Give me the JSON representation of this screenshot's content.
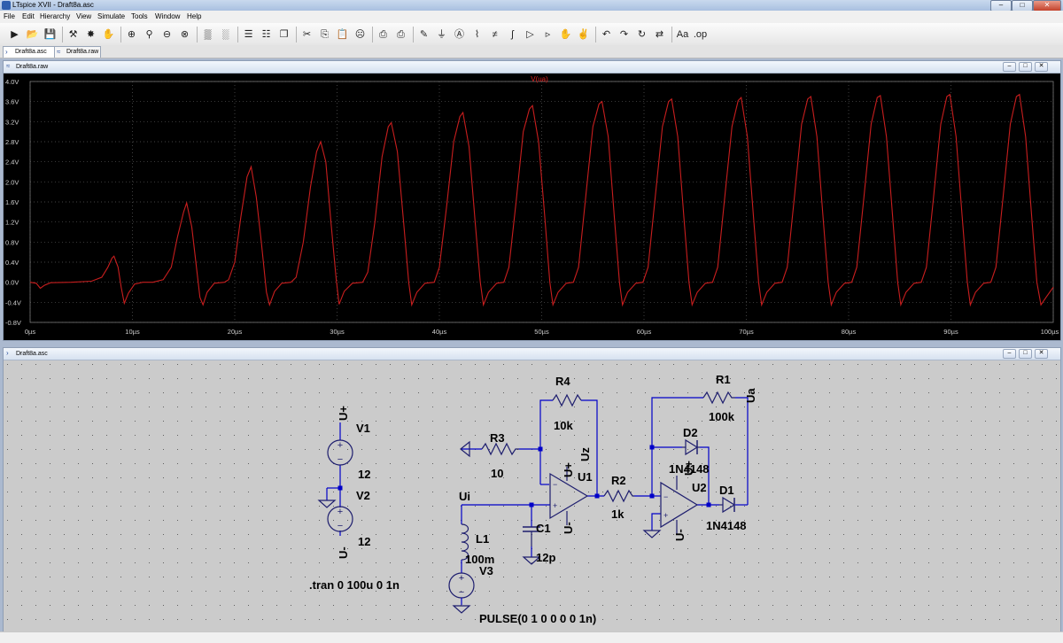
{
  "window": {
    "title": "LTspice XVII - Draft8a.asc",
    "minimize": "–",
    "maximize": "□",
    "close": "✕"
  },
  "menu": [
    "File",
    "Edit",
    "Hierarchy",
    "View",
    "Simulate",
    "Tools",
    "Window",
    "Help"
  ],
  "toolbar": [
    {
      "icon": "new-schematic-icon",
      "glyph": "▶"
    },
    {
      "icon": "open-folder-icon",
      "glyph": "📂"
    },
    {
      "icon": "save-icon",
      "glyph": "💾"
    },
    {
      "icon": "control-panel-icon",
      "glyph": "⚒"
    },
    {
      "icon": "run-icon",
      "glyph": "✸"
    },
    {
      "icon": "pan-icon",
      "glyph": "✋"
    },
    {
      "icon": "zoom-in-icon",
      "glyph": "⊕"
    },
    {
      "icon": "zoom-icon",
      "glyph": "⚲"
    },
    {
      "icon": "zoom-out-icon",
      "glyph": "⊖"
    },
    {
      "icon": "zoom-cancel-icon",
      "glyph": "⊗"
    },
    {
      "icon": "autorange-icon",
      "glyph": "▒"
    },
    {
      "icon": "fit-icon",
      "glyph": "░"
    },
    {
      "icon": "tile-horizontal-icon",
      "glyph": "☰"
    },
    {
      "icon": "tile-vertical-icon",
      "glyph": "☷"
    },
    {
      "icon": "cascade-icon",
      "glyph": "❐"
    },
    {
      "icon": "cut-icon",
      "glyph": "✂"
    },
    {
      "icon": "copy-icon",
      "glyph": "⎘"
    },
    {
      "icon": "paste-icon",
      "glyph": "📋"
    },
    {
      "icon": "find-icon",
      "glyph": "☹"
    },
    {
      "icon": "print-icon",
      "glyph": "⎙"
    },
    {
      "icon": "print-setup-icon",
      "glyph": "⎙"
    },
    {
      "icon": "draw-wire-icon",
      "glyph": "✎"
    },
    {
      "icon": "ground-icon",
      "glyph": "⏚"
    },
    {
      "icon": "label-net-icon",
      "glyph": "Ⓐ"
    },
    {
      "icon": "resistor-icon",
      "glyph": "⌇"
    },
    {
      "icon": "capacitor-icon",
      "glyph": "≠"
    },
    {
      "icon": "inductor-icon",
      "glyph": "ʃ"
    },
    {
      "icon": "diode-icon",
      "glyph": "▷"
    },
    {
      "icon": "component-icon",
      "glyph": "▹"
    },
    {
      "icon": "move-icon",
      "glyph": "✋"
    },
    {
      "icon": "drag-icon",
      "glyph": "✌"
    },
    {
      "icon": "undo-icon",
      "glyph": "↶"
    },
    {
      "icon": "redo-icon",
      "glyph": "↷"
    },
    {
      "icon": "rotate-icon",
      "glyph": "↻"
    },
    {
      "icon": "mirror-icon",
      "glyph": "⇄"
    },
    {
      "icon": "text-icon",
      "glyph": "Aa"
    },
    {
      "icon": "spice-directive-icon",
      "glyph": ".op"
    }
  ],
  "tabs": [
    {
      "label": "Draft8a.asc",
      "icon": "schematic-tab-icon"
    },
    {
      "label": "Draft8a.raw",
      "icon": "waveform-tab-icon"
    }
  ],
  "plot_window": {
    "title": "Draft8a.raw"
  },
  "schematic_window": {
    "title": "Draft8a.asc"
  },
  "colors": {
    "trace": "#c81e1e",
    "plot_bg": "#000000",
    "grid": "#5a5a5a",
    "wire": "#0000c8",
    "component": "#1e1e6e",
    "schematic_bg": "#cbcbcb"
  },
  "chart_data": {
    "type": "line",
    "series": [
      {
        "name": "V(ua)",
        "x_unit": "µs",
        "points": [
          [
            0,
            0.0
          ],
          [
            0.6,
            -0.02
          ],
          [
            1.0,
            -0.12
          ],
          [
            1.4,
            -0.06
          ],
          [
            2,
            -0.01
          ],
          [
            4,
            0.0
          ],
          [
            6,
            0.02
          ],
          [
            7,
            0.1
          ],
          [
            7.6,
            0.3
          ],
          [
            8,
            0.48
          ],
          [
            8.2,
            0.52
          ],
          [
            8.6,
            0.3
          ],
          [
            8.9,
            -0.1
          ],
          [
            9.2,
            -0.42
          ],
          [
            9.6,
            -0.22
          ],
          [
            10.2,
            -0.04
          ],
          [
            11,
            0.0
          ],
          [
            12,
            0.0
          ],
          [
            13,
            0.05
          ],
          [
            13.8,
            0.3
          ],
          [
            14.4,
            0.9
          ],
          [
            15,
            1.4
          ],
          [
            15.3,
            1.58
          ],
          [
            15.8,
            1.1
          ],
          [
            16.2,
            0.4
          ],
          [
            16.6,
            -0.3
          ],
          [
            16.9,
            -0.45
          ],
          [
            17.3,
            -0.2
          ],
          [
            18,
            -0.02
          ],
          [
            19,
            0.0
          ],
          [
            19.4,
            0.05
          ],
          [
            20,
            0.4
          ],
          [
            20.6,
            1.3
          ],
          [
            21.2,
            2.1
          ],
          [
            21.6,
            2.3
          ],
          [
            22.1,
            1.7
          ],
          [
            22.6,
            0.8
          ],
          [
            23.1,
            -0.2
          ],
          [
            23.4,
            -0.45
          ],
          [
            23.9,
            -0.18
          ],
          [
            24.6,
            -0.02
          ],
          [
            25.5,
            0.0
          ],
          [
            26,
            0.1
          ],
          [
            26.7,
            0.8
          ],
          [
            27.4,
            1.9
          ],
          [
            28,
            2.6
          ],
          [
            28.4,
            2.8
          ],
          [
            28.9,
            2.4
          ],
          [
            29.4,
            1.2
          ],
          [
            29.9,
            0.1
          ],
          [
            30.2,
            -0.44
          ],
          [
            30.7,
            -0.18
          ],
          [
            31.5,
            -0.02
          ],
          [
            32.5,
            0.0
          ],
          [
            33,
            0.2
          ],
          [
            33.7,
            1.2
          ],
          [
            34.4,
            2.5
          ],
          [
            35,
            3.1
          ],
          [
            35.3,
            3.18
          ],
          [
            35.9,
            2.6
          ],
          [
            36.5,
            1.2
          ],
          [
            37,
            0.0
          ],
          [
            37.3,
            -0.45
          ],
          [
            37.8,
            -0.2
          ],
          [
            38.6,
            -0.02
          ],
          [
            39.5,
            0.0
          ],
          [
            40,
            0.3
          ],
          [
            40.7,
            1.5
          ],
          [
            41.4,
            2.8
          ],
          [
            42,
            3.3
          ],
          [
            42.3,
            3.38
          ],
          [
            42.9,
            2.7
          ],
          [
            43.5,
            1.2
          ],
          [
            44,
            0.0
          ],
          [
            44.3,
            -0.45
          ],
          [
            44.8,
            -0.2
          ],
          [
            45.6,
            -0.02
          ],
          [
            46.3,
            0.0
          ],
          [
            46.8,
            0.3
          ],
          [
            47.5,
            1.6
          ],
          [
            48.2,
            3.0
          ],
          [
            48.8,
            3.45
          ],
          [
            49.1,
            3.52
          ],
          [
            49.7,
            2.8
          ],
          [
            50.3,
            1.3
          ],
          [
            50.8,
            0.0
          ],
          [
            51.1,
            -0.45
          ],
          [
            51.6,
            -0.2
          ],
          [
            52.4,
            -0.02
          ],
          [
            53.1,
            0.0
          ],
          [
            53.6,
            0.3
          ],
          [
            54.3,
            1.7
          ],
          [
            55,
            3.1
          ],
          [
            55.6,
            3.55
          ],
          [
            55.9,
            3.6
          ],
          [
            56.5,
            2.9
          ],
          [
            57.1,
            1.3
          ],
          [
            57.6,
            0.0
          ],
          [
            57.9,
            -0.45
          ],
          [
            58.4,
            -0.2
          ],
          [
            59.2,
            -0.02
          ],
          [
            59.9,
            0.0
          ],
          [
            60.4,
            0.3
          ],
          [
            61.1,
            1.7
          ],
          [
            61.8,
            3.1
          ],
          [
            62.4,
            3.6
          ],
          [
            62.7,
            3.65
          ],
          [
            63.3,
            2.9
          ],
          [
            63.9,
            1.3
          ],
          [
            64.4,
            0.0
          ],
          [
            64.7,
            -0.45
          ],
          [
            65.2,
            -0.2
          ],
          [
            66,
            -0.02
          ],
          [
            66.7,
            0.0
          ],
          [
            67.2,
            0.3
          ],
          [
            67.9,
            1.7
          ],
          [
            68.6,
            3.1
          ],
          [
            69.2,
            3.62
          ],
          [
            69.5,
            3.68
          ],
          [
            70.1,
            2.9
          ],
          [
            70.7,
            1.3
          ],
          [
            71.2,
            0.0
          ],
          [
            71.5,
            -0.45
          ],
          [
            72,
            -0.2
          ],
          [
            72.8,
            -0.02
          ],
          [
            73.5,
            0.0
          ],
          [
            74,
            0.3
          ],
          [
            74.7,
            1.7
          ],
          [
            75.4,
            3.15
          ],
          [
            76,
            3.65
          ],
          [
            76.3,
            3.7
          ],
          [
            76.9,
            2.9
          ],
          [
            77.5,
            1.3
          ],
          [
            78,
            0.0
          ],
          [
            78.3,
            -0.45
          ],
          [
            78.8,
            -0.2
          ],
          [
            79.6,
            -0.02
          ],
          [
            80.3,
            0.0
          ],
          [
            80.8,
            0.3
          ],
          [
            81.5,
            1.7
          ],
          [
            82.2,
            3.15
          ],
          [
            82.8,
            3.68
          ],
          [
            83.1,
            3.72
          ],
          [
            83.7,
            2.9
          ],
          [
            84.3,
            1.3
          ],
          [
            84.8,
            0.0
          ],
          [
            85.1,
            -0.45
          ],
          [
            85.6,
            -0.2
          ],
          [
            86.4,
            -0.02
          ],
          [
            87.1,
            0.0
          ],
          [
            87.6,
            0.3
          ],
          [
            88.3,
            1.7
          ],
          [
            89,
            3.15
          ],
          [
            89.6,
            3.7
          ],
          [
            89.9,
            3.74
          ],
          [
            90.5,
            2.9
          ],
          [
            91.1,
            1.3
          ],
          [
            91.6,
            0.0
          ],
          [
            91.9,
            -0.45
          ],
          [
            92.4,
            -0.2
          ],
          [
            93.2,
            -0.02
          ],
          [
            93.9,
            0.0
          ],
          [
            94.4,
            0.3
          ],
          [
            95.1,
            1.7
          ],
          [
            95.8,
            3.15
          ],
          [
            96.4,
            3.7
          ],
          [
            96.7,
            3.74
          ],
          [
            97.3,
            2.9
          ],
          [
            97.9,
            1.3
          ],
          [
            98.4,
            0.0
          ],
          [
            98.8,
            -0.45
          ],
          [
            99.3,
            -0.3
          ],
          [
            100,
            -0.1
          ]
        ]
      }
    ],
    "xlim": [
      0,
      100
    ],
    "ylim": [
      -0.8,
      4.0
    ],
    "x_ticks": [
      {
        "v": 0,
        "label": "0µs"
      },
      {
        "v": 10,
        "label": "10µs"
      },
      {
        "v": 20,
        "label": "20µs"
      },
      {
        "v": 30,
        "label": "30µs"
      },
      {
        "v": 40,
        "label": "40µs"
      },
      {
        "v": 50,
        "label": "50µs"
      },
      {
        "v": 60,
        "label": "60µs"
      },
      {
        "v": 70,
        "label": "70µs"
      },
      {
        "v": 80,
        "label": "80µs"
      },
      {
        "v": 90,
        "label": "90µs"
      },
      {
        "v": 100,
        "label": "100µs"
      }
    ],
    "y_ticks": [
      {
        "v": 4.0,
        "label": "4.0V"
      },
      {
        "v": 3.6,
        "label": "3.6V"
      },
      {
        "v": 3.2,
        "label": "3.2V"
      },
      {
        "v": 2.8,
        "label": "2.8V"
      },
      {
        "v": 2.4,
        "label": "2.4V"
      },
      {
        "v": 2.0,
        "label": "2.0V"
      },
      {
        "v": 1.6,
        "label": "1.6V"
      },
      {
        "v": 1.2,
        "label": "1.2V"
      },
      {
        "v": 0.8,
        "label": "0.8V"
      },
      {
        "v": 0.4,
        "label": "0.4V"
      },
      {
        "v": 0.0,
        "label": "0.0V"
      },
      {
        "v": -0.4,
        "label": "-0.4V"
      },
      {
        "v": -0.8,
        "label": "-0.8V"
      }
    ],
    "grid": true
  },
  "schematic": {
    "labels": {
      "v1_name": "V1",
      "v1_value": "12",
      "v2_name": "V2",
      "v2_value": "12",
      "uplus_top": "U+",
      "uminus_bottom": "U-",
      "directive": ".tran 0 100u 0 1n",
      "r3_name": "R3",
      "r3_value": "10",
      "r4_name": "R4",
      "r4_value": "10k",
      "u1_name": "U1",
      "u1_plus": "U+",
      "u1_minus": "U-",
      "uz": "Uz",
      "ui": "Ui",
      "c1_name": "C1",
      "c1_value": "12p",
      "l1_name": "L1",
      "l1_value": "100m",
      "v3_name": "V3",
      "v3_value": "PULSE(0 1 0 0 0 0 1n)",
      "r2_name": "R2",
      "r2_value": "1k",
      "r1_name": "R1",
      "r1_value": "100k",
      "ua": "Ua",
      "d2_name": "D2",
      "d2_value": "1N4148",
      "d1_name": "D1",
      "d1_value": "1N4148",
      "u2_name": "U2",
      "u2_plus": "U+",
      "u2_minus": "U-",
      "opamp_plus": "+",
      "opamp_minus": "−"
    }
  }
}
